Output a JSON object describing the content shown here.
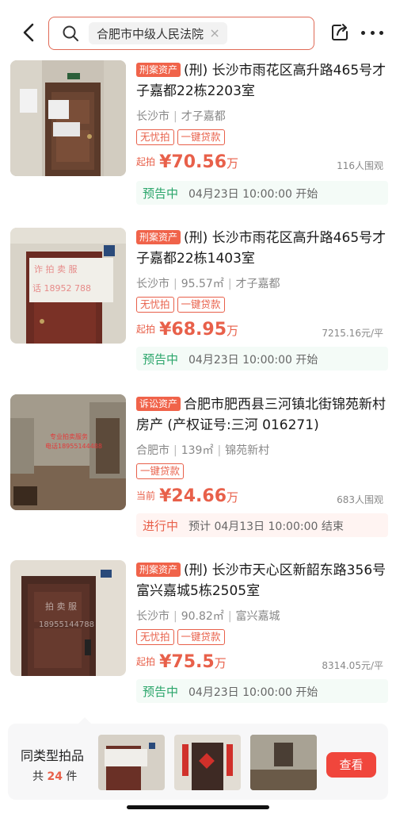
{
  "search": {
    "query": "合肥市中级人民法院"
  },
  "listings": [
    {
      "type_tag": "刑案资产",
      "title": "(刑) 长沙市雨花区高升路465号才子嘉都22栋2203室",
      "meta": [
        "长沙市",
        "才子嘉都"
      ],
      "badges": [
        "无忧拍",
        "一键贷款"
      ],
      "price_label": "起拍",
      "price_value": "¥70.56",
      "price_unit": "万",
      "side_info": "116人围观",
      "status_tag": "预告中",
      "status_text": "04月23日 10:00:00 开始"
    },
    {
      "type_tag": "刑案资产",
      "title": "(刑) 长沙市雨花区高升路465号才子嘉都22栋1403室",
      "meta": [
        "长沙市",
        "95.57㎡",
        "才子嘉都"
      ],
      "badges": [
        "无忧拍",
        "一键贷款"
      ],
      "price_label": "起拍",
      "price_value": "¥68.95",
      "price_unit": "万",
      "side_info": "7215.16元/平",
      "status_tag": "预告中",
      "status_text": "04月23日 10:00:00 开始"
    },
    {
      "type_tag": "诉讼资产",
      "title": "合肥市肥西县三河镇北街锦苑新村房产 (产权证号:三河 016271)",
      "meta": [
        "合肥市",
        "139㎡",
        "锦苑新村"
      ],
      "badges": [
        "一键贷款"
      ],
      "price_label": "当前",
      "price_value": "¥24.66",
      "price_unit": "万",
      "side_info": "683人围观",
      "status_tag": "进行中",
      "status_text": "预计 04月13日 10:00:00 结束"
    },
    {
      "type_tag": "刑案资产",
      "title": "(刑) 长沙市天心区新韶东路356号富兴嘉城5栋2505室",
      "meta": [
        "长沙市",
        "90.82㎡",
        "富兴嘉城"
      ],
      "badges": [
        "无忧拍",
        "一键贷款"
      ],
      "price_label": "起拍",
      "price_value": "¥75.5",
      "price_unit": "万",
      "side_info": "8314.05元/平",
      "status_tag": "预告中",
      "status_text": "04月23日 10:00:00 开始"
    }
  ],
  "similar": {
    "title": "同类型拍品",
    "count_prefix": "共",
    "count": "24",
    "count_suffix": "件",
    "button": "查看"
  },
  "colors": {
    "accent": "#e8604a",
    "status_green": "#2aa56a",
    "button_red": "#f0463c"
  }
}
